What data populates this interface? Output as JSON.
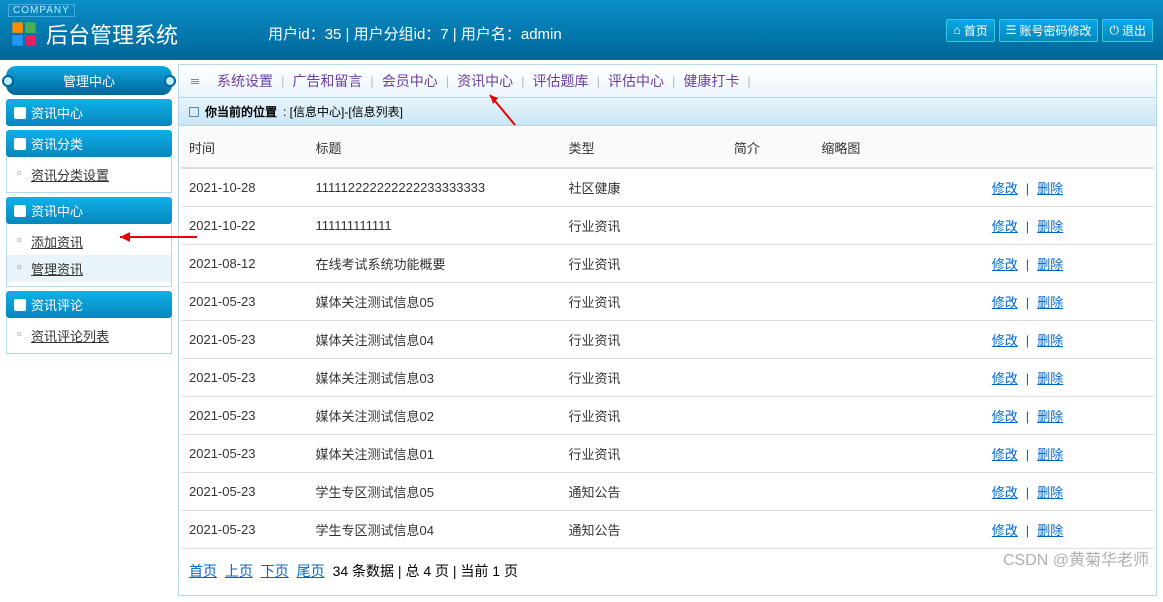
{
  "header": {
    "company": "COMPANY",
    "title": "后台管理系统",
    "user_line": "用户id：35 | 用户分组id：7 | 用户名：admin",
    "btn_home": "首页",
    "btn_pwd": "账号密码修改",
    "btn_exit": "退出"
  },
  "sidebar": {
    "center": "管理中心",
    "heading": "资讯中心",
    "sections": [
      {
        "title": "资讯分类",
        "items": [
          "资讯分类设置"
        ]
      },
      {
        "title": "资讯中心",
        "items": [
          "添加资讯",
          "管理资讯"
        ]
      },
      {
        "title": "资讯评论",
        "items": [
          "资讯评论列表"
        ]
      }
    ]
  },
  "topnav": [
    "系统设置",
    "广告和留言",
    "会员中心",
    "资讯中心",
    "评估题库",
    "评估中心",
    "健康打卡"
  ],
  "breadcrumb": {
    "label": "你当前的位置",
    "path": ": [信息中心]-[信息列表]"
  },
  "table": {
    "headers": [
      "时间",
      "标题",
      "类型",
      "简介",
      "缩略图",
      ""
    ],
    "rows": [
      {
        "time": "2021-10-28",
        "title": "111112222222222233333333",
        "type": "社区健康"
      },
      {
        "time": "2021-10-22",
        "title": "111111111111",
        "type": "行业资讯"
      },
      {
        "time": "2021-08-12",
        "title": "在线考试系统功能概要",
        "type": "行业资讯"
      },
      {
        "time": "2021-05-23",
        "title": "媒体关注测试信息05",
        "type": "行业资讯"
      },
      {
        "time": "2021-05-23",
        "title": "媒体关注测试信息04",
        "type": "行业资讯"
      },
      {
        "time": "2021-05-23",
        "title": "媒体关注测试信息03",
        "type": "行业资讯"
      },
      {
        "time": "2021-05-23",
        "title": "媒体关注测试信息02",
        "type": "行业资讯"
      },
      {
        "time": "2021-05-23",
        "title": "媒体关注测试信息01",
        "type": "行业资讯"
      },
      {
        "time": "2021-05-23",
        "title": "学生专区测试信息05",
        "type": "通知公告"
      },
      {
        "time": "2021-05-23",
        "title": "学生专区测试信息04",
        "type": "通知公告"
      }
    ],
    "act_edit": "修改",
    "act_del": "删除"
  },
  "pager": {
    "first": "首页",
    "prev": "上页",
    "next": "下页",
    "last": "尾页",
    "info": "34 条数据 | 总 4 页 | 当前 1 页"
  },
  "watermark": "CSDN @黄菊华老师"
}
